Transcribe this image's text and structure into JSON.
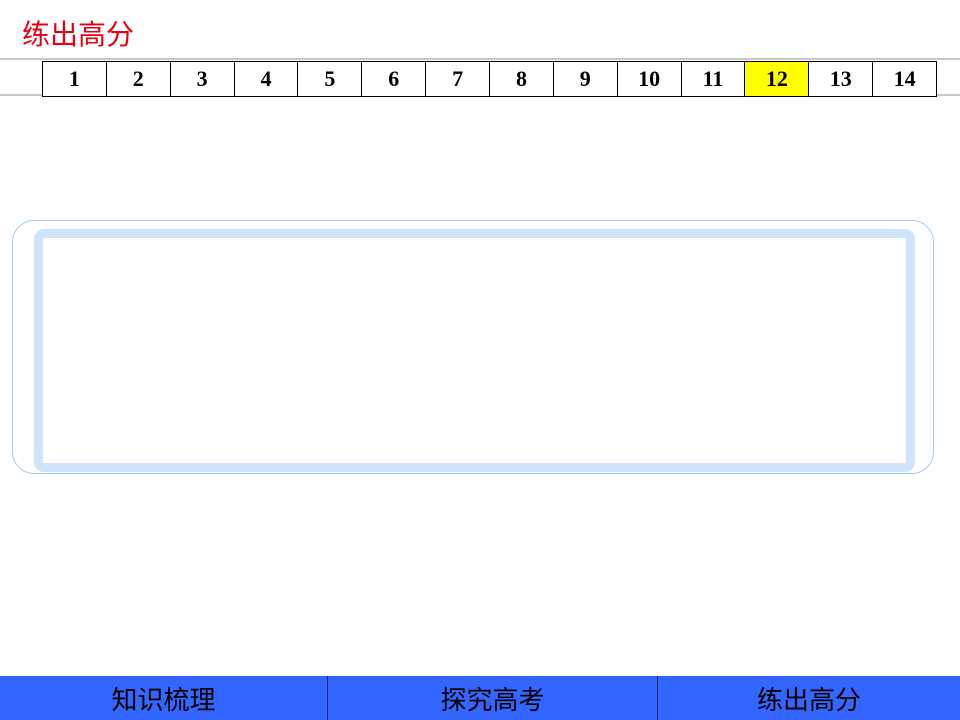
{
  "header": {
    "section_title": "练出高分"
  },
  "question_nav": {
    "items": [
      "1",
      "2",
      "3",
      "4",
      "5",
      "6",
      "7",
      "8",
      "9",
      "10",
      "11",
      "12",
      "13",
      "14"
    ],
    "active": "12",
    "active_color": "#ffff00"
  },
  "footer": {
    "tabs": [
      {
        "label": "知识梳理"
      },
      {
        "label": "探究高考"
      },
      {
        "label": "练出高分"
      }
    ],
    "bar_color": "#3366ff"
  },
  "colors": {
    "title": "#e60012",
    "frame_border": "#9ecbf0",
    "frame_inner": "#cfe4fa"
  }
}
